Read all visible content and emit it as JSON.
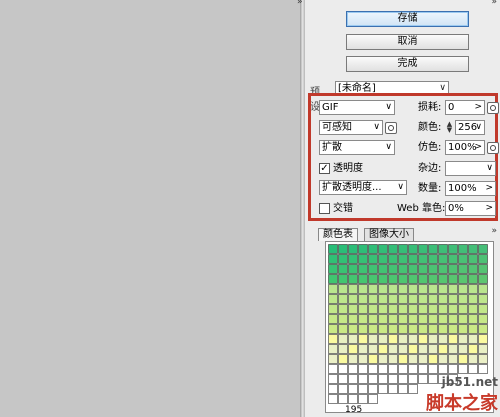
{
  "buttons": {
    "save": "存储",
    "cancel": "取消",
    "done": "完成"
  },
  "preset": {
    "label": "预设:",
    "value": "[未命名]"
  },
  "settings": {
    "format": "GIF",
    "reduction": "可感知",
    "dither_algo": "扩散",
    "transparency_label": "透明度",
    "transparency_checked": true,
    "transparency_dither": "扩散透明度...",
    "interlaced_label": "交错",
    "interlaced_checked": false,
    "lossy_label": "损耗:",
    "lossy_value": "0",
    "colors_label": "颜色:",
    "colors_value": "256",
    "dither_label": "仿色:",
    "dither_value": "100%",
    "matte_label": "杂边:",
    "matte_value": "",
    "amount_label": "数量:",
    "amount_value": "100%",
    "web_snap_label": "Web 靠色:",
    "web_snap_value": "0%"
  },
  "tabs": [
    {
      "label": "颜色表"
    },
    {
      "label": "图像大小"
    }
  ],
  "color_table": {
    "count": "195"
  },
  "watermark": {
    "line1": "jb51.net",
    "line2": "脚本之家"
  }
}
